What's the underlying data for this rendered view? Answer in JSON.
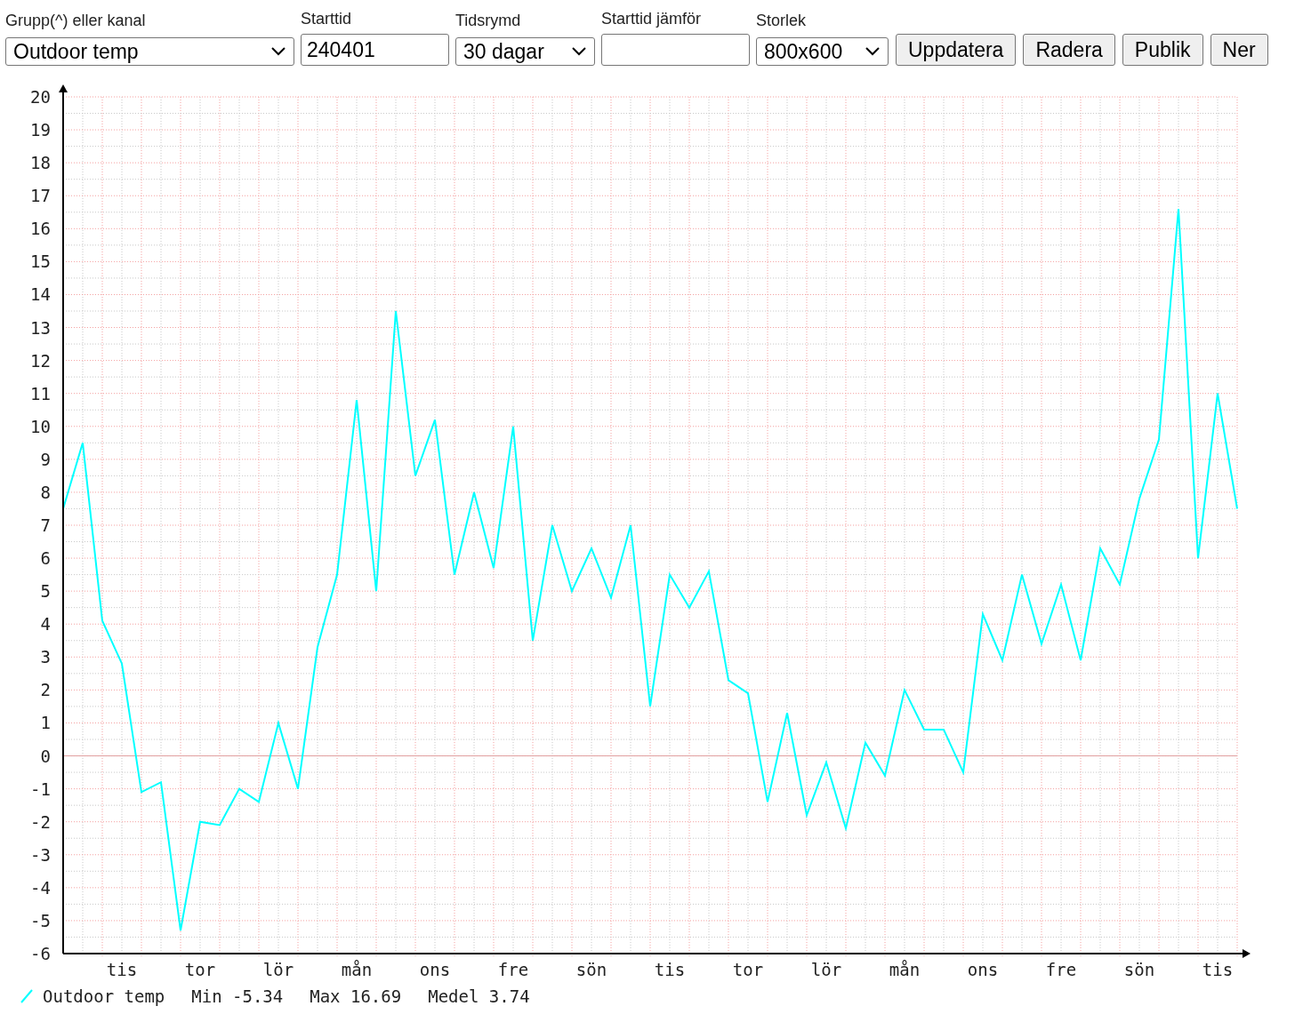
{
  "form": {
    "fields": [
      {
        "kind": "select",
        "label": "Grupp(^) eller kanal",
        "value": "Outdoor temp"
      },
      {
        "kind": "text",
        "label": "Starttid",
        "value": "240401"
      },
      {
        "kind": "select",
        "label": "Tidsrymd",
        "value": "30 dagar"
      },
      {
        "kind": "text",
        "label": "Starttid jämför"
      },
      {
        "kind": "select",
        "label": "Storlek",
        "value": "800x600"
      }
    ],
    "buttons": [
      "Uppdatera",
      "Radera",
      "Publik",
      "Ner"
    ]
  },
  "chart": {
    "chart_data": {
      "type": "line",
      "grid": true,
      "ref_lines": [
        {
          "axis": "y",
          "value": 0
        }
      ],
      "ylim": [
        -6,
        20
      ],
      "yticks": [
        -6,
        -5,
        -4,
        -3,
        -2,
        -1,
        0,
        1,
        2,
        3,
        4,
        5,
        6,
        7,
        8,
        9,
        10,
        11,
        12,
        13,
        14,
        15,
        16,
        17,
        18,
        19,
        20
      ],
      "categories": [
        null,
        null,
        null,
        "tis",
        null,
        null,
        null,
        "tor",
        null,
        null,
        null,
        "lör",
        null,
        null,
        null,
        "mån",
        null,
        null,
        null,
        "ons",
        null,
        null,
        null,
        "fre",
        null,
        null,
        null,
        "sön",
        null,
        null,
        null,
        "tis",
        null,
        null,
        null,
        "tor",
        null,
        null,
        null,
        "lör",
        null,
        null,
        null,
        "mån",
        null,
        null,
        null,
        "ons",
        null,
        null,
        null,
        "fre",
        null,
        null,
        null,
        "sön",
        null,
        null,
        null,
        "tis",
        null
      ],
      "series": [
        {
          "name": "Outdoor temp",
          "color": "#00ffff",
          "values": [
            7.5,
            9.5,
            4.1,
            2.8,
            -1.1,
            -0.8,
            -5.3,
            -2,
            -2.1,
            -1,
            -1.4,
            1,
            -1,
            3.3,
            5.5,
            10.8,
            5,
            13.5,
            8.5,
            10.2,
            5.5,
            8,
            5.7,
            10,
            3.5,
            7,
            5,
            6.3,
            4.8,
            7,
            1.5,
            5.5,
            4.5,
            5.6,
            2.3,
            1.9,
            -1.4,
            1.3,
            -1.8,
            -0.2,
            -2.2,
            0.4,
            -0.6,
            2,
            0.8,
            0.8,
            -0.5,
            4.3,
            2.9,
            5.5,
            3.4,
            5.2,
            2.9,
            6.3,
            5.2,
            7.8,
            9.6,
            16.6,
            6,
            11,
            7.5
          ]
        }
      ]
    }
  },
  "legend": {
    "stats": [
      "Min -5.34",
      "Max 16.69",
      "Medel 3.74"
    ]
  }
}
